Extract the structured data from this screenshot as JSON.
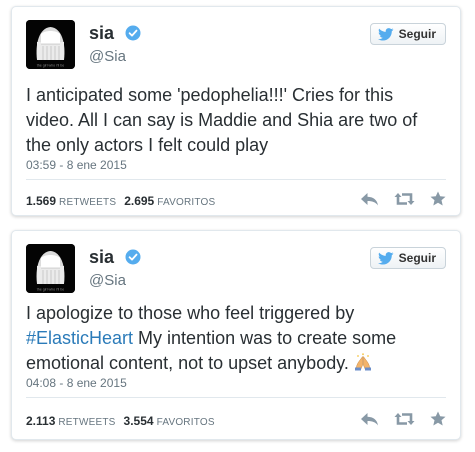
{
  "tweets": [
    {
      "author": {
        "name": "sia",
        "handle": "@Sia",
        "verified": true
      },
      "avatar_caption": "the girl who i'll be",
      "follow_label": "Seguir",
      "text_lines": [
        "I anticipated some 'pedophelia!!!' Cries for this",
        "video. All I can say is Maddie and Shia are two of",
        "the only actors I felt could play"
      ],
      "timestamp": "03:59 - 8 ene 2015",
      "retweets": {
        "count": "1.569",
        "label": "RETWEETS"
      },
      "favorites": {
        "count": "2.695",
        "label": "FAVORITOS"
      },
      "actions": [
        "reply-icon",
        "retweet-icon",
        "favorite-star-icon"
      ]
    },
    {
      "author": {
        "name": "sia",
        "handle": "@Sia",
        "verified": true
      },
      "avatar_caption": "the girl who i'll be",
      "follow_label": "Seguir",
      "text_line1": "I apologize to those who feel triggered by",
      "hashtag": "#ElasticHeart",
      "text_line2_rest": " My intention was to create some",
      "text_line3": "emotional content, not to upset anybody. ",
      "emoji": "folded-hands-emoji",
      "timestamp": "04:08 - 8 ene 2015",
      "retweets": {
        "count": "2.113",
        "label": "RETWEETS"
      },
      "favorites": {
        "count": "3.554",
        "label": "FAVORITOS"
      },
      "actions": [
        "reply-icon",
        "retweet-icon",
        "favorite-star-icon"
      ]
    }
  ],
  "colors": {
    "text": "#292f33",
    "muted": "#66757f",
    "hashtag": "#2b7bb9",
    "verified": "#55acee",
    "twitter_bird": "#55acee",
    "border": "#e1e8ed",
    "action_icon": "#8899a6"
  }
}
